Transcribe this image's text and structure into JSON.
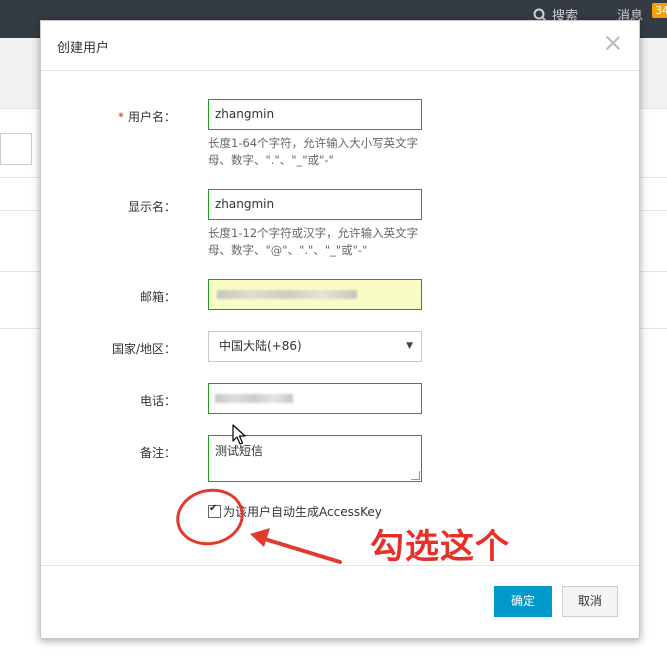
{
  "topbar": {
    "search_label": "搜索",
    "messages_label": "消息",
    "messages_count": "34"
  },
  "dialog": {
    "title": "创建用户",
    "fields": {
      "username": {
        "label": "用户名：",
        "required_mark": "*",
        "value": "zhangmin",
        "hint": "长度1-64个字符，允许输入大小写英文字母、数字、\".\"、\"_\"或\"-\""
      },
      "display_name": {
        "label": "显示名：",
        "value": "zhangmin",
        "hint": "长度1-12个字符或汉字，允许输入英文字母、数字、\"@\"、\".\"、\"_\"或\"-\""
      },
      "email": {
        "label": "邮箱："
      },
      "country": {
        "label": "国家/地区：",
        "selected": "中国大陆(+86)"
      },
      "phone": {
        "label": "电话："
      },
      "note": {
        "label": "备注：",
        "value": "测试短信"
      }
    },
    "auto_accesskey": {
      "label": "为该用户自动生成AccessKey",
      "checked": true
    },
    "buttons": {
      "ok": "确定",
      "cancel": "取消"
    }
  },
  "annotation": {
    "text": "勾选这个",
    "color": "#e8302a"
  },
  "colors": {
    "primary": "#0099cc",
    "valid_border": "#1f9b1f",
    "autofill_bg": "#fafcc6"
  }
}
